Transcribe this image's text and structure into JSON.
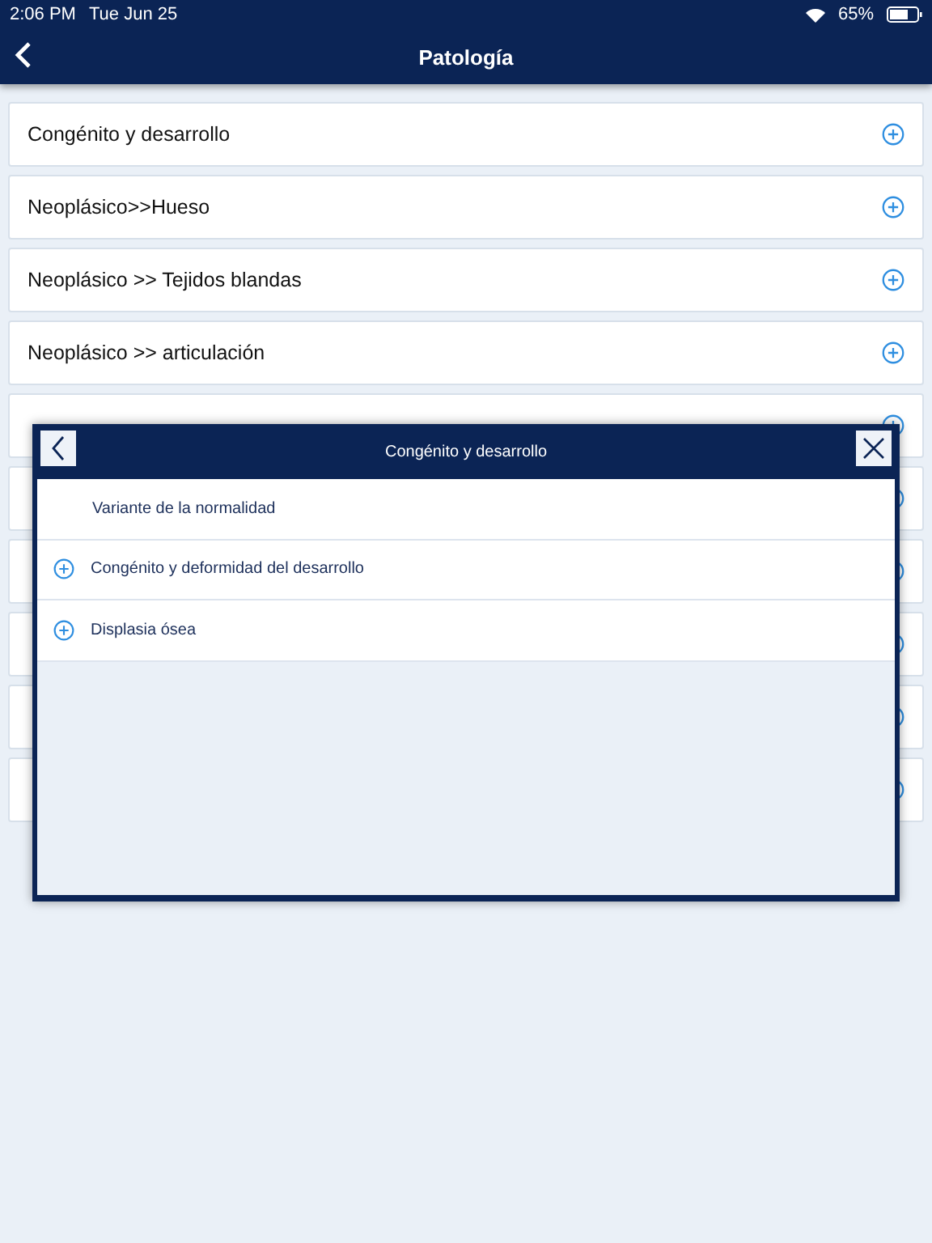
{
  "status_bar": {
    "time": "2:06 PM",
    "date": "Tue Jun 25",
    "battery": "65%"
  },
  "nav": {
    "title": "Patología"
  },
  "categories": [
    {
      "label": "Congénito y desarrollo"
    },
    {
      "label": "Neoplásico>>Hueso"
    },
    {
      "label": "Neoplásico >> Tejidos blandas"
    },
    {
      "label": "Neoplásico >> articulación"
    }
  ],
  "dialog": {
    "title": "Congénito y desarrollo",
    "items": [
      {
        "label": "Variante de la normalidad",
        "expandable": false
      },
      {
        "label": "Congénito y deformidad del desarrollo",
        "expandable": true
      },
      {
        "label": "Displasia ósea",
        "expandable": true
      }
    ]
  }
}
